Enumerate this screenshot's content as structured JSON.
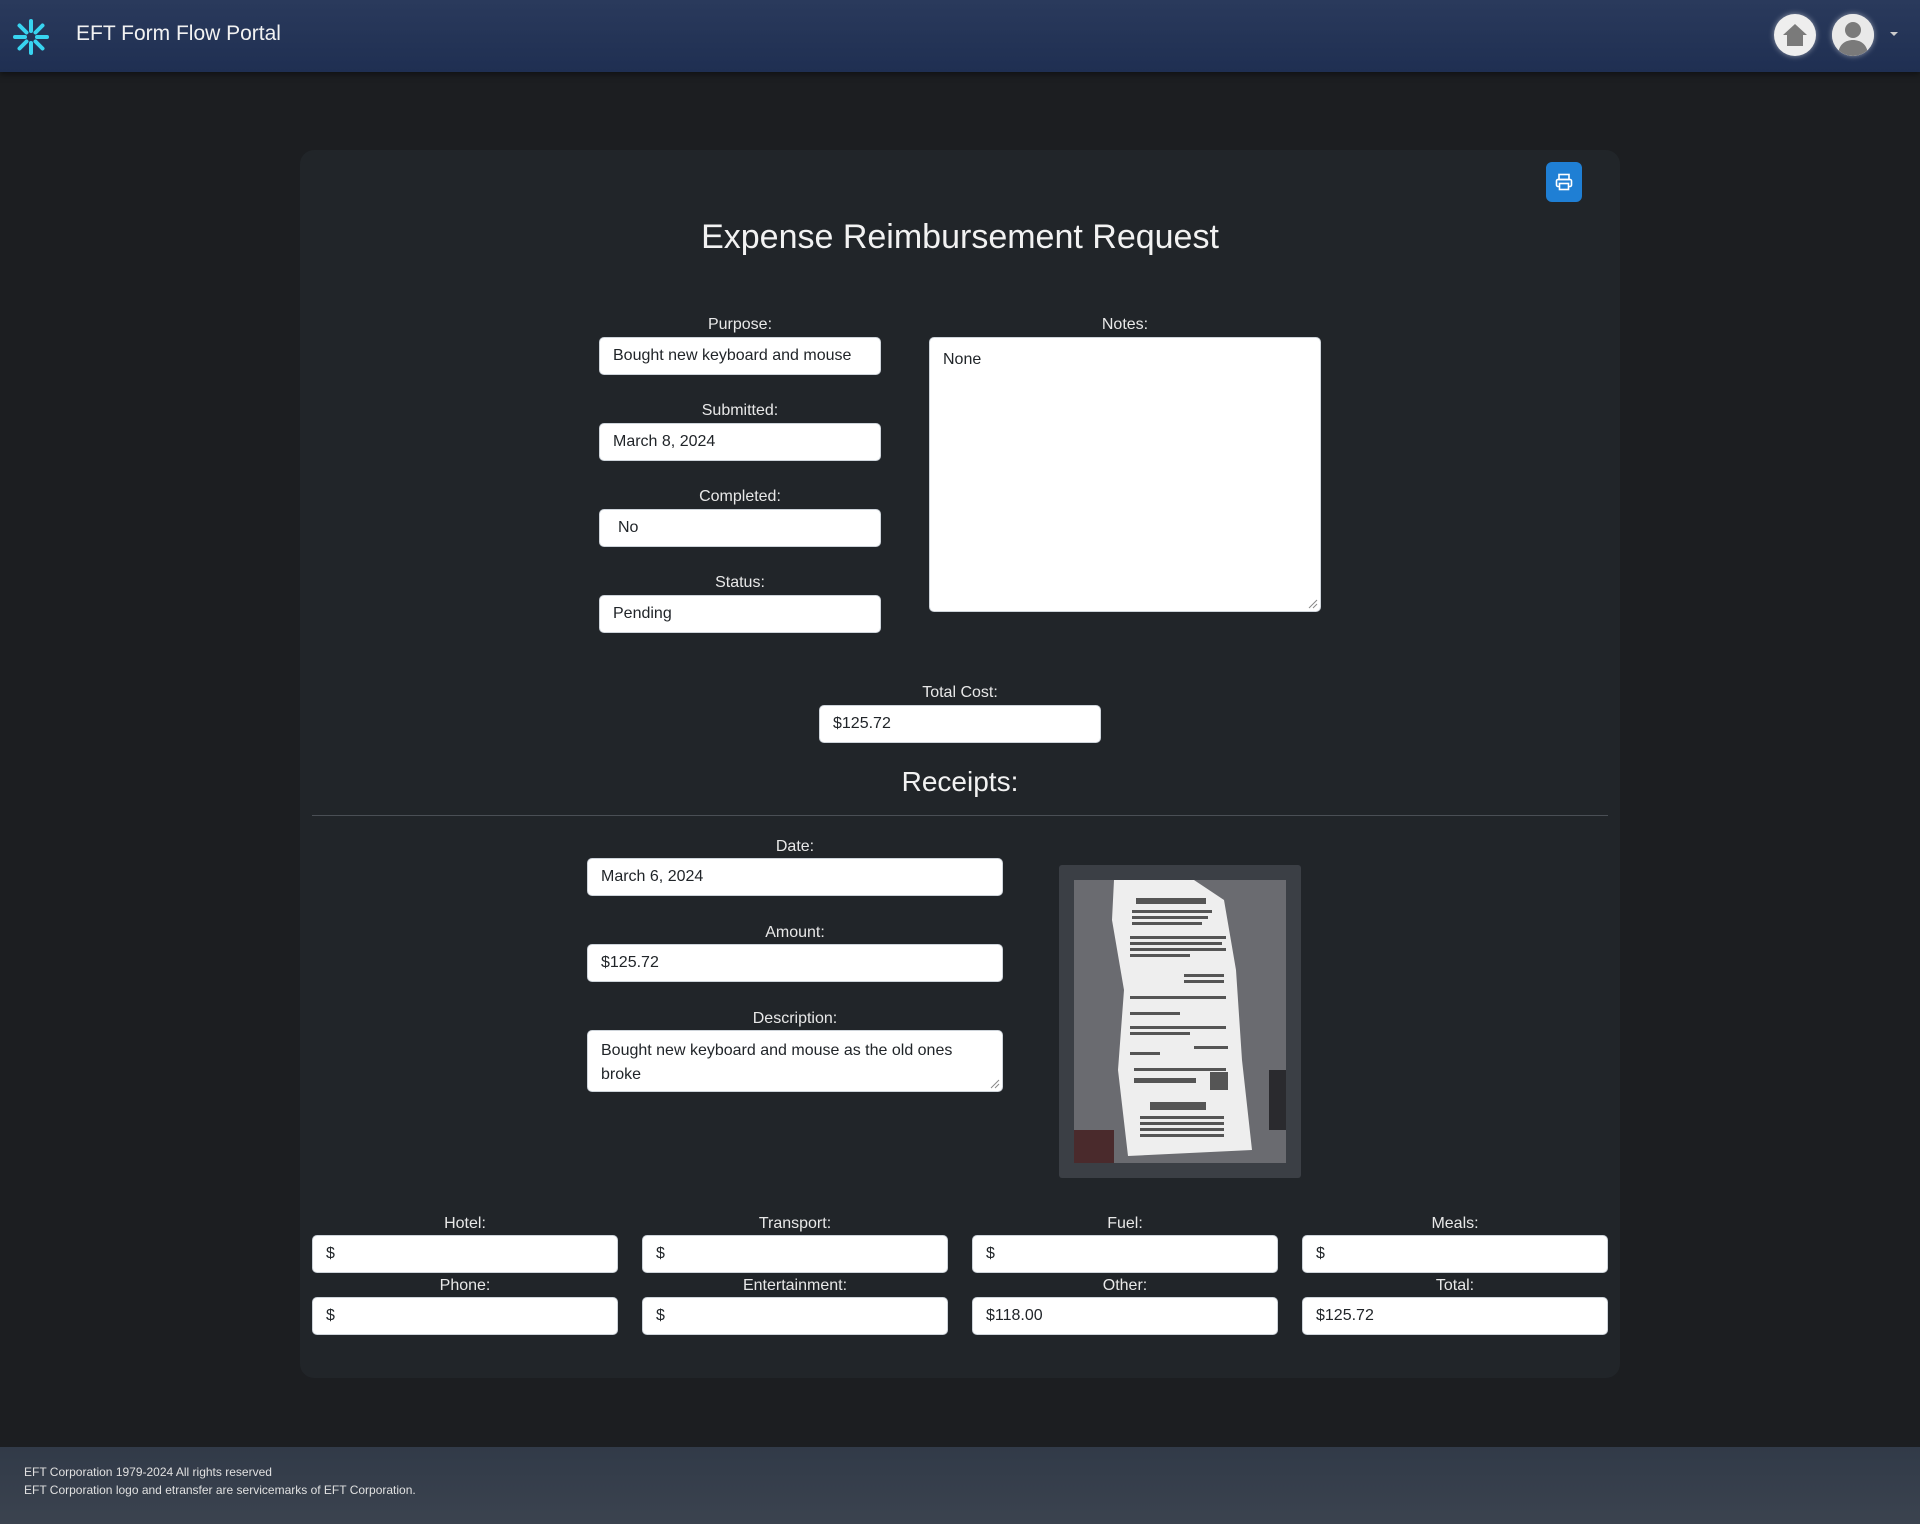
{
  "header": {
    "app_title": "EFT Form Flow Portal",
    "icons": [
      "spinner-logo-icon",
      "home-icon",
      "user-avatar-icon",
      "chevron-down-icon"
    ]
  },
  "form": {
    "title": "Expense Reimbursement Request",
    "print_icon": "printer-icon",
    "purpose_label": "Purpose:",
    "purpose_value": "Bought new keyboard and mouse",
    "submitted_label": "Submitted:",
    "submitted_value": "March 8, 2024",
    "completed_label": "Completed:",
    "completed_value": "No",
    "status_label": "Status:",
    "status_value": "Pending",
    "notes_label": "Notes:",
    "notes_value": "None",
    "total_cost_label": "Total Cost:",
    "total_cost_value": "$125.72"
  },
  "receipts": {
    "title": "Receipts:",
    "date_label": "Date:",
    "date_value": "March 6, 2024",
    "amount_label": "Amount:",
    "amount_value": "$125.72",
    "description_label": "Description:",
    "description_value": "Bought new keyboard and mouse as the old ones broke",
    "image": "receipt-photo"
  },
  "categories": [
    {
      "label": "Hotel:",
      "value": "$"
    },
    {
      "label": "Transport:",
      "value": "$"
    },
    {
      "label": "Fuel:",
      "value": "$"
    },
    {
      "label": "Meals:",
      "value": "$"
    },
    {
      "label": "Phone:",
      "value": "$"
    },
    {
      "label": "Entertainment:",
      "value": "$"
    },
    {
      "label": "Other:",
      "value": "$118.00"
    },
    {
      "label": "Total:",
      "value": "$125.72"
    }
  ],
  "footer": {
    "line1": "EFT Corporation 1979-2024 All rights reserved",
    "line2": "EFT Corporation logo and etransfer are servicemarks of EFT Corporation."
  },
  "colors": {
    "header_bg": "#1f2f52",
    "page_bg": "#1c1e21",
    "card_bg": "#212529",
    "accent": "#1f7fd4",
    "logo": "#38d4f0"
  }
}
